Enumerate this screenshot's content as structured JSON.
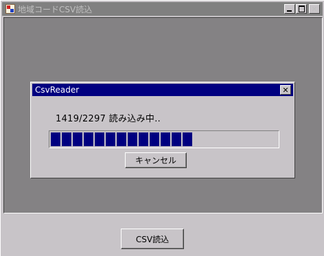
{
  "window": {
    "title": "地域コードCSV読込",
    "minimize_icon": "minimize-icon",
    "maximize_icon": "maximize-icon",
    "close_icon": "close-icon",
    "close_glyph": "✕"
  },
  "dialog": {
    "title": "CsvReader",
    "close_glyph": "✕",
    "status_text": "1419/2297 読み込み中‥",
    "progress": {
      "current": 1419,
      "total": 2297,
      "fraction": 0.62
    },
    "cancel_label": "キャンセル"
  },
  "main": {
    "read_button_label": "CSV読込"
  },
  "colors": {
    "dialog_titlebar": "#000080",
    "inactive_titlebar": "#808080",
    "panel_bg": "#848284",
    "progress_fill": "#000080"
  }
}
